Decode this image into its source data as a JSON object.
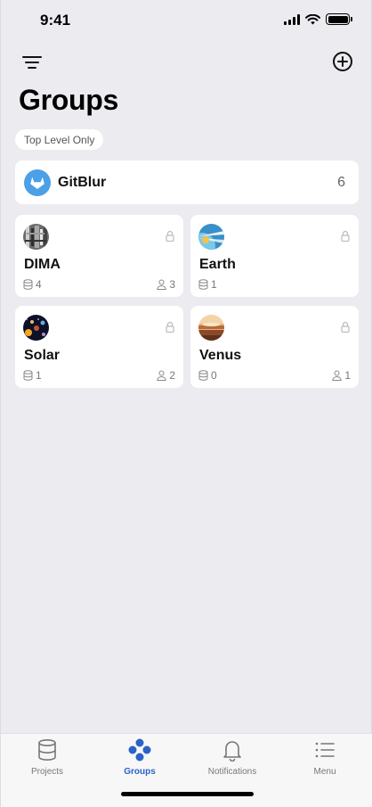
{
  "status": {
    "time": "9:41"
  },
  "header": {
    "title": "Groups"
  },
  "filter_chip": "Top Level Only",
  "top_group": {
    "name": "GitBlur",
    "count": "6"
  },
  "groups": [
    {
      "name": "DIMA",
      "projects": "4",
      "members": "3",
      "avatar": "dima-photo"
    },
    {
      "name": "Earth",
      "projects": "1",
      "members": "",
      "avatar": "earth-photo"
    },
    {
      "name": "Solar",
      "projects": "1",
      "members": "2",
      "avatar": "solar-photo"
    },
    {
      "name": "Venus",
      "projects": "0",
      "members": "1",
      "avatar": "venus-photo"
    }
  ],
  "tabs": [
    {
      "label": "Projects",
      "icon": "database-icon",
      "active": false
    },
    {
      "label": "Groups",
      "icon": "groups-icon",
      "active": true
    },
    {
      "label": "Notifications",
      "icon": "bell-icon",
      "active": false
    },
    {
      "label": "Menu",
      "icon": "list-icon",
      "active": false
    }
  ],
  "colors": {
    "accent": "#2b62c8",
    "background": "#ebebf0",
    "card": "#ffffff"
  }
}
